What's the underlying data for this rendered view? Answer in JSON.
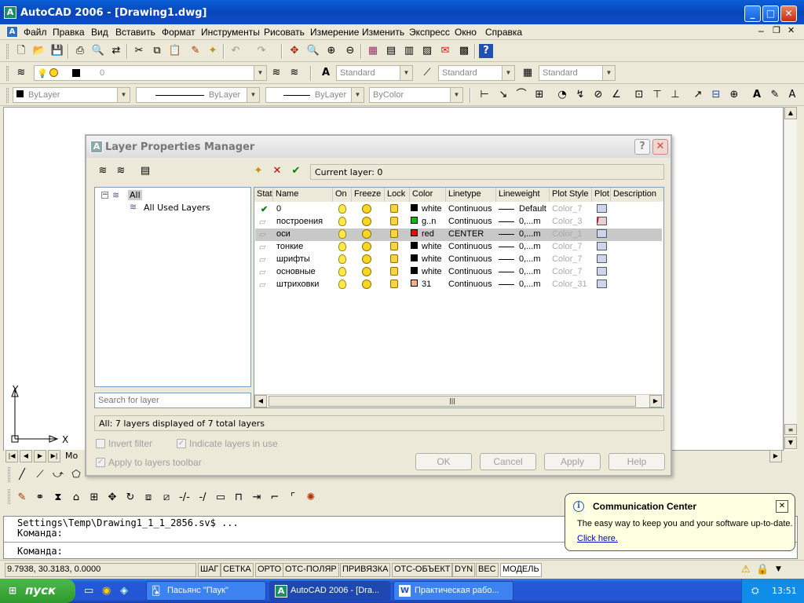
{
  "app": {
    "title": "AutoCAD 2006 - [Drawing1.dwg]",
    "logo": "A"
  },
  "menu": [
    "Файл",
    "Правка",
    "Вид",
    "Вставить",
    "Формат",
    "Инструменты",
    "Рисовать",
    "Измерение",
    "Изменить",
    "Экспресс",
    "Окно",
    "Справка"
  ],
  "toolbar": {
    "layer_value": "0",
    "text_style": "Standard",
    "dim_style": "Standard",
    "table_style": "Standard",
    "color": "ByLayer",
    "linetype": "ByLayer",
    "lineweight": "ByLayer",
    "plotstyle": "ByColor"
  },
  "ucs": {
    "x": "X",
    "y": "Y"
  },
  "model_tab": "Mo",
  "dialog": {
    "title": "Layer Properties Manager",
    "help_glyph": "?",
    "close_glyph": "✕",
    "current_layer": "Current layer: 0",
    "tree": {
      "root": "All",
      "child": "All Used Layers"
    },
    "search_placeholder": "Search for layer",
    "columns": [
      "Stat",
      "Name",
      "On",
      "Freeze",
      "Lock",
      "Color",
      "Linetype",
      "Lineweight",
      "Plot Style",
      "Plot",
      "Description"
    ],
    "layers": [
      {
        "status": "current",
        "name": "0",
        "color_hex": "#000000",
        "color": "white",
        "linetype": "Continuous",
        "lineweight": "Default",
        "plotstyle": "Color_7",
        "plot": true
      },
      {
        "status": "",
        "name": "построения",
        "color_hex": "#00c000",
        "color": "g..n",
        "linetype": "Continuous",
        "lineweight": "0,...m",
        "plotstyle": "Color_3",
        "plot": false
      },
      {
        "status": "selected",
        "name": "оси",
        "color_hex": "#ff0000",
        "color": "red",
        "linetype": "CENTER",
        "lineweight": "0,...m",
        "plotstyle": "Color_1",
        "plot": true
      },
      {
        "status": "",
        "name": "тонкие",
        "color_hex": "#000000",
        "color": "white",
        "linetype": "Continuous",
        "lineweight": "0,...m",
        "plotstyle": "Color_7",
        "plot": true
      },
      {
        "status": "",
        "name": "шрифты",
        "color_hex": "#000000",
        "color": "white",
        "linetype": "Continuous",
        "lineweight": "0,...m",
        "plotstyle": "Color_7",
        "plot": true
      },
      {
        "status": "",
        "name": "основные",
        "color_hex": "#000000",
        "color": "white",
        "linetype": "Continuous",
        "lineweight": "0,...m",
        "plotstyle": "Color_7",
        "plot": true
      },
      {
        "status": "",
        "name": "штриховки",
        "color_hex": "#f4b080",
        "color": "31",
        "linetype": "Continuous",
        "lineweight": "0,...m",
        "plotstyle": "Color_31",
        "plot": true
      }
    ],
    "status_text": "All: 7 layers displayed of 7 total layers",
    "invert_filter": "Invert filter",
    "indicate_layers": "Indicate layers in use",
    "apply_toolbar": "Apply to layers toolbar",
    "buttons": {
      "ok": "OK",
      "cancel": "Cancel",
      "apply": "Apply",
      "help": "Help"
    }
  },
  "command": {
    "line1": "Settings\\Temp\\Drawing1_1_1_2856.sv$ ...",
    "line2": "Команда:",
    "line3": "Команда:"
  },
  "status": {
    "coords": "9.7938, 30.3183, 0.0000",
    "toggles": [
      "ШАГ",
      "СЕТКА",
      "ОРТО",
      "ОТС-ПОЛЯР",
      "ПРИВЯЗКА",
      "ОТС-ОБЪЕКТ",
      "DYN",
      "ВЕС",
      "МОДЕЛЬ"
    ]
  },
  "balloon": {
    "title": "Communication Center",
    "text": "The easy way to keep you and your software up-to-date.",
    "link": "Click here.",
    "close": "✕",
    "info": "i"
  },
  "taskbar": {
    "start": "пуск",
    "tasks": [
      "Пасьянс \"Паук\"",
      "AutoCAD 2006 - [Dra...",
      "Практическая рабо..."
    ],
    "clock": "13:51"
  }
}
